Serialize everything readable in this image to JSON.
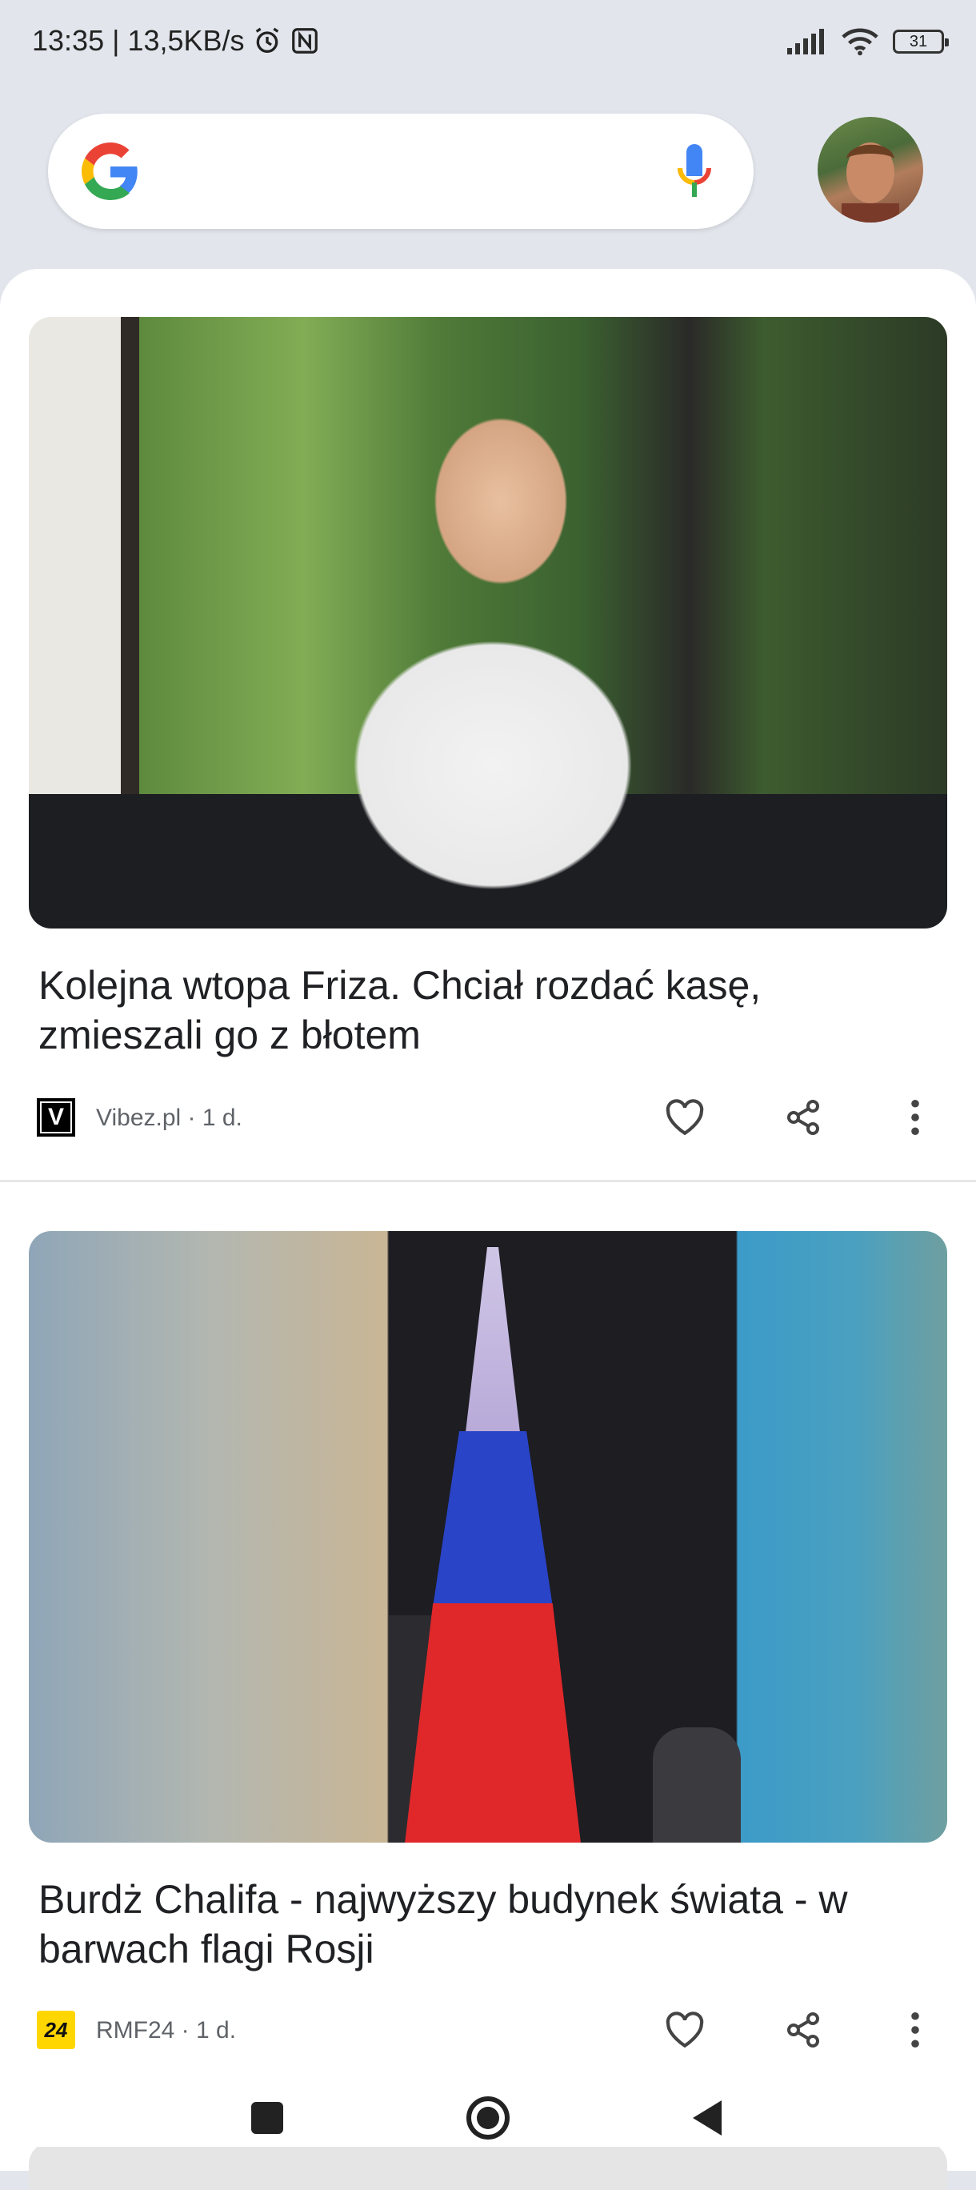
{
  "status_bar": {
    "time_speed": "13:35 | 13,5KB/s",
    "battery_level": "31",
    "icons": [
      "alarm-icon",
      "nfc-icon",
      "signal-icon",
      "wifi-icon",
      "battery-icon"
    ]
  },
  "search": {
    "logo_icon": "google-g-icon",
    "mic_icon": "voice-search-icon",
    "avatar_icon": "profile-avatar"
  },
  "articles": [
    {
      "headline": "Kolejna wtopa Friza. Chciał rozdać kasę, zmieszali go z błotem",
      "source_logo": "V",
      "source": "Vibez.pl · 1 d."
    },
    {
      "headline": "Burdż Chalifa - najwyższy budynek świata - w barwach flagi Rosji",
      "source_logo": "24",
      "source": "RMF24 · 1 d."
    }
  ],
  "colors": {
    "background": "#e2e6ec",
    "card": "#ffffff",
    "text_primary": "#202124",
    "text_secondary": "#5f6368",
    "rmf_yellow": "#ffd600"
  },
  "nav": {
    "icons": [
      "recents-square-icon",
      "home-circle-icon",
      "back-triangle-icon"
    ]
  }
}
